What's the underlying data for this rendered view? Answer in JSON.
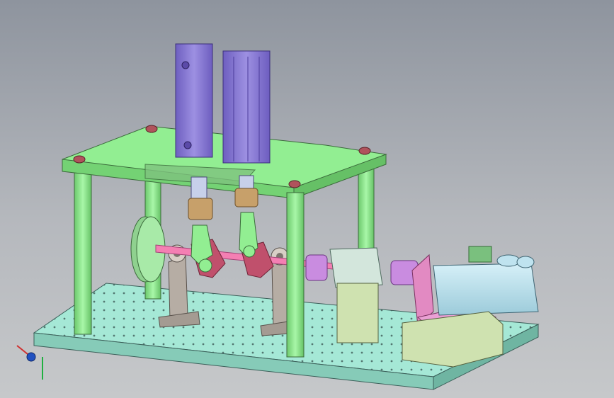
{
  "scene": {
    "type": "3D CAD assembly view",
    "background": [
      "#8e949e",
      "#c6c8ca"
    ],
    "colors": {
      "breadboard": "#a5e8d6",
      "support_structure": "#92ee92",
      "cylinders": "#8c7fd6",
      "crankshaft": "#f47fb3",
      "rod_crank": "#c0506c",
      "bearings": "#b8b0a8",
      "coupling": "#c98ce0",
      "bearing_housing": "#d3e6dc",
      "motor_body": "#bfe3ef",
      "motor_bracket": "#e28ac2",
      "motor_pad": "#eaa0d4",
      "blocks": "#cfe2b0",
      "bolts": "#b0535c",
      "sensor": "#7ac07e",
      "fittings": "#c7a06a"
    },
    "axis_triad": {
      "x_axis_color": "#d03030",
      "y_axis_color": "#20b040",
      "z_axis_color": "#2050c0"
    }
  }
}
